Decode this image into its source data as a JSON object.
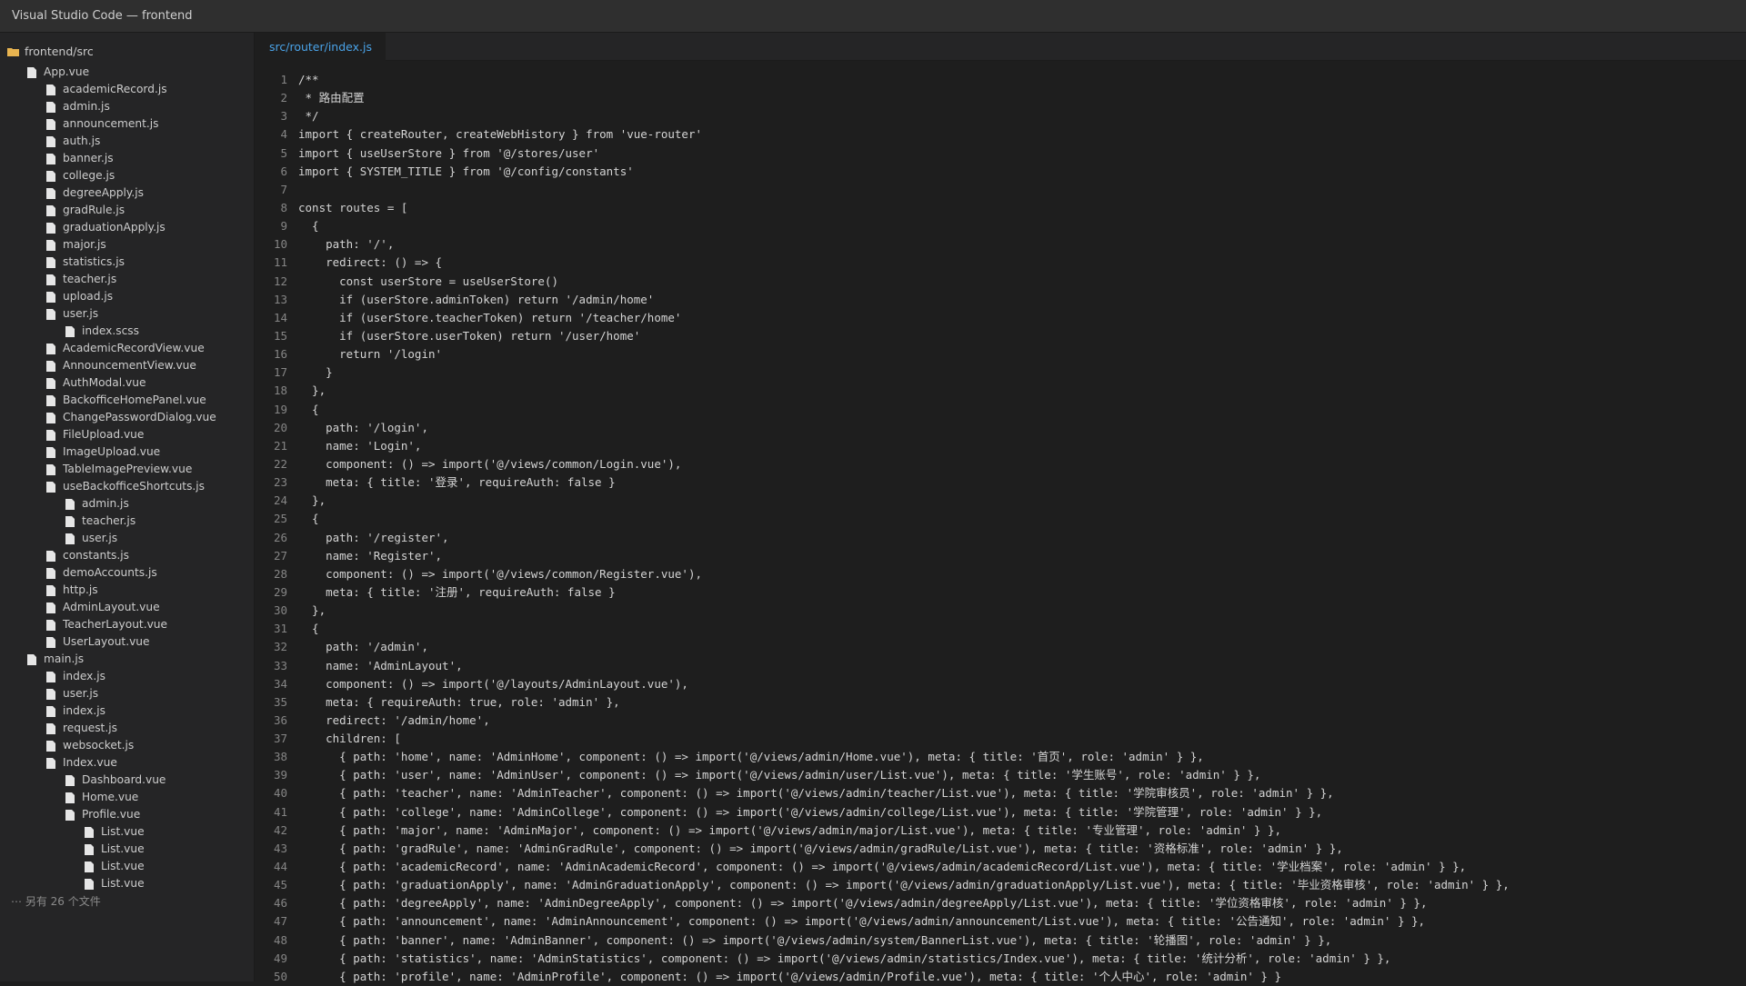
{
  "window": {
    "title": "Visual Studio Code — frontend"
  },
  "explorer": {
    "root": "frontend/src",
    "items": [
      {
        "label": "App.vue",
        "depth": 1
      },
      {
        "label": "academicRecord.js",
        "depth": 2
      },
      {
        "label": "admin.js",
        "depth": 2
      },
      {
        "label": "announcement.js",
        "depth": 2
      },
      {
        "label": "auth.js",
        "depth": 2
      },
      {
        "label": "banner.js",
        "depth": 2
      },
      {
        "label": "college.js",
        "depth": 2
      },
      {
        "label": "degreeApply.js",
        "depth": 2
      },
      {
        "label": "gradRule.js",
        "depth": 2
      },
      {
        "label": "graduationApply.js",
        "depth": 2
      },
      {
        "label": "major.js",
        "depth": 2
      },
      {
        "label": "statistics.js",
        "depth": 2
      },
      {
        "label": "teacher.js",
        "depth": 2
      },
      {
        "label": "upload.js",
        "depth": 2
      },
      {
        "label": "user.js",
        "depth": 2
      },
      {
        "label": "index.scss",
        "depth": 3
      },
      {
        "label": "AcademicRecordView.vue",
        "depth": 2
      },
      {
        "label": "AnnouncementView.vue",
        "depth": 2
      },
      {
        "label": "AuthModal.vue",
        "depth": 2
      },
      {
        "label": "BackofficeHomePanel.vue",
        "depth": 2
      },
      {
        "label": "ChangePasswordDialog.vue",
        "depth": 2
      },
      {
        "label": "FileUpload.vue",
        "depth": 2
      },
      {
        "label": "ImageUpload.vue",
        "depth": 2
      },
      {
        "label": "TableImagePreview.vue",
        "depth": 2
      },
      {
        "label": "useBackofficeShortcuts.js",
        "depth": 2
      },
      {
        "label": "admin.js",
        "depth": 3
      },
      {
        "label": "teacher.js",
        "depth": 3
      },
      {
        "label": "user.js",
        "depth": 3
      },
      {
        "label": "constants.js",
        "depth": 2
      },
      {
        "label": "demoAccounts.js",
        "depth": 2
      },
      {
        "label": "http.js",
        "depth": 2
      },
      {
        "label": "AdminLayout.vue",
        "depth": 2
      },
      {
        "label": "TeacherLayout.vue",
        "depth": 2
      },
      {
        "label": "UserLayout.vue",
        "depth": 2
      },
      {
        "label": "main.js",
        "depth": 1
      },
      {
        "label": "index.js",
        "depth": 2
      },
      {
        "label": "user.js",
        "depth": 2
      },
      {
        "label": "index.js",
        "depth": 2
      },
      {
        "label": "request.js",
        "depth": 2
      },
      {
        "label": "websocket.js",
        "depth": 2
      },
      {
        "label": "Index.vue",
        "depth": 2
      },
      {
        "label": "Dashboard.vue",
        "depth": 3
      },
      {
        "label": "Home.vue",
        "depth": 3
      },
      {
        "label": "Profile.vue",
        "depth": 3
      },
      {
        "label": "List.vue",
        "depth": 4
      },
      {
        "label": "List.vue",
        "depth": 4
      },
      {
        "label": "List.vue",
        "depth": 4
      },
      {
        "label": "List.vue",
        "depth": 4
      }
    ],
    "more_files": "⋯ 另有 26 个文件"
  },
  "editor": {
    "active_tab": "src/router/index.js",
    "lines": [
      "/**",
      " * 路由配置",
      " */",
      "import { createRouter, createWebHistory } from 'vue-router'",
      "import { useUserStore } from '@/stores/user'",
      "import { SYSTEM_TITLE } from '@/config/constants'",
      "",
      "const routes = [",
      "  {",
      "    path: '/',",
      "    redirect: () => {",
      "      const userStore = useUserStore()",
      "      if (userStore.adminToken) return '/admin/home'",
      "      if (userStore.teacherToken) return '/teacher/home'",
      "      if (userStore.userToken) return '/user/home'",
      "      return '/login'",
      "    }",
      "  },",
      "  {",
      "    path: '/login',",
      "    name: 'Login',",
      "    component: () => import('@/views/common/Login.vue'),",
      "    meta: { title: '登录', requireAuth: false }",
      "  },",
      "  {",
      "    path: '/register',",
      "    name: 'Register',",
      "    component: () => import('@/views/common/Register.vue'),",
      "    meta: { title: '注册', requireAuth: false }",
      "  },",
      "  {",
      "    path: '/admin',",
      "    name: 'AdminLayout',",
      "    component: () => import('@/layouts/AdminLayout.vue'),",
      "    meta: { requireAuth: true, role: 'admin' },",
      "    redirect: '/admin/home',",
      "    children: [",
      "      { path: 'home', name: 'AdminHome', component: () => import('@/views/admin/Home.vue'), meta: { title: '首页', role: 'admin' } },",
      "      { path: 'user', name: 'AdminUser', component: () => import('@/views/admin/user/List.vue'), meta: { title: '学生账号', role: 'admin' } },",
      "      { path: 'teacher', name: 'AdminTeacher', component: () => import('@/views/admin/teacher/List.vue'), meta: { title: '学院审核员', role: 'admin' } },",
      "      { path: 'college', name: 'AdminCollege', component: () => import('@/views/admin/college/List.vue'), meta: { title: '学院管理', role: 'admin' } },",
      "      { path: 'major', name: 'AdminMajor', component: () => import('@/views/admin/major/List.vue'), meta: { title: '专业管理', role: 'admin' } },",
      "      { path: 'gradRule', name: 'AdminGradRule', component: () => import('@/views/admin/gradRule/List.vue'), meta: { title: '资格标准', role: 'admin' } },",
      "      { path: 'academicRecord', name: 'AdminAcademicRecord', component: () => import('@/views/admin/academicRecord/List.vue'), meta: { title: '学业档案', role: 'admin' } },",
      "      { path: 'graduationApply', name: 'AdminGraduationApply', component: () => import('@/views/admin/graduationApply/List.vue'), meta: { title: '毕业资格审核', role: 'admin' } },",
      "      { path: 'degreeApply', name: 'AdminDegreeApply', component: () => import('@/views/admin/degreeApply/List.vue'), meta: { title: '学位资格审核', role: 'admin' } },",
      "      { path: 'announcement', name: 'AdminAnnouncement', component: () => import('@/views/admin/announcement/List.vue'), meta: { title: '公告通知', role: 'admin' } },",
      "      { path: 'banner', name: 'AdminBanner', component: () => import('@/views/admin/system/BannerList.vue'), meta: { title: '轮播图', role: 'admin' } },",
      "      { path: 'statistics', name: 'AdminStatistics', component: () => import('@/views/admin/statistics/Index.vue'), meta: { title: '统计分析', role: 'admin' } },",
      "      { path: 'profile', name: 'AdminProfile', component: () => import('@/views/admin/Profile.vue'), meta: { title: '个人中心', role: 'admin' } }"
    ]
  }
}
